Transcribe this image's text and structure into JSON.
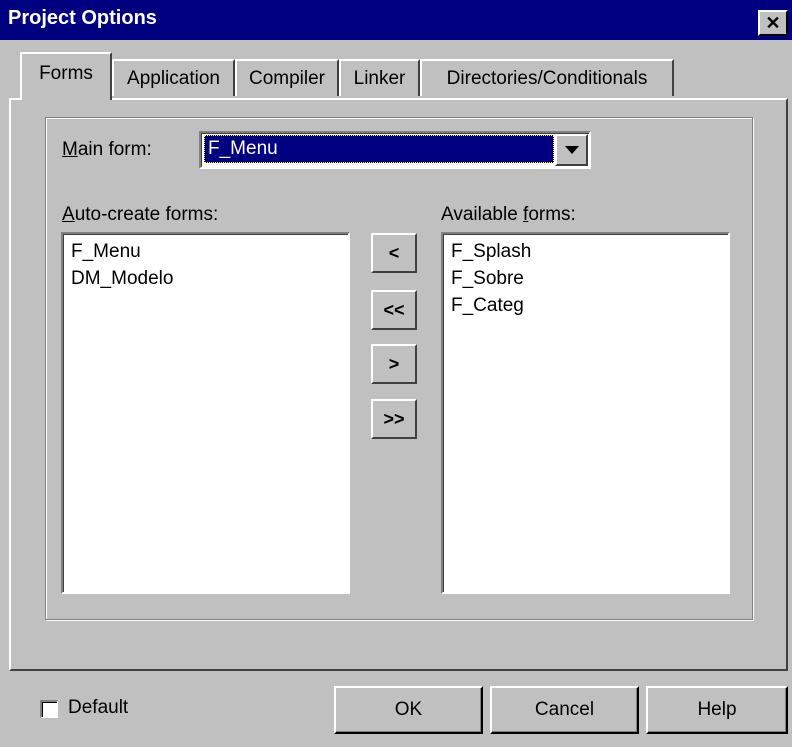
{
  "window": {
    "title": "Project Options",
    "close_glyph": "✕"
  },
  "tabs": [
    {
      "label": "Forms",
      "active": true
    },
    {
      "label": "Application",
      "active": false
    },
    {
      "label": "Compiler",
      "active": false
    },
    {
      "label": "Linker",
      "active": false
    },
    {
      "label": "Directories/Conditionals",
      "active": false
    }
  ],
  "main_form": {
    "label_accel": "M",
    "label_rest": "ain form:",
    "value": "F_Menu"
  },
  "auto_create": {
    "label_accel": "A",
    "label_rest": "uto-create forms:",
    "items": [
      "F_Menu",
      "DM_Modelo"
    ]
  },
  "available": {
    "label_pre": "Available ",
    "label_accel": "f",
    "label_rest": "orms:",
    "items": [
      "F_Splash",
      "F_Sobre",
      "F_Categ"
    ]
  },
  "move_buttons": {
    "include": "<",
    "include_all": "<<",
    "exclude": ">",
    "exclude_all": ">>"
  },
  "footer": {
    "default_label": "Default",
    "default_checked": false,
    "ok": "OK",
    "cancel": "Cancel",
    "help": "Help"
  }
}
